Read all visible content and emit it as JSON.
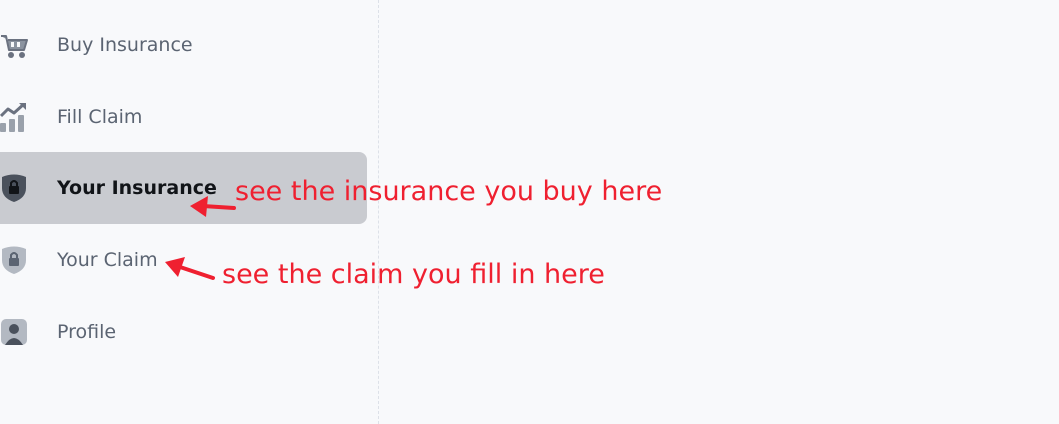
{
  "sidebar": {
    "items": [
      {
        "label": "Buy Insurance",
        "icon": "cart-icon",
        "active": false
      },
      {
        "label": "Fill Claim",
        "icon": "chart-trend-icon",
        "active": false
      },
      {
        "label": "Your Insurance",
        "icon": "shield-lock-icon",
        "active": true
      },
      {
        "label": "Your Claim",
        "icon": "shield-lock-icon",
        "active": false
      },
      {
        "label": "Profile",
        "icon": "user-icon",
        "active": false
      }
    ]
  },
  "annotations": {
    "insurance_note": "see the insurance you buy here",
    "claim_note": "see the claim you fill in here",
    "color": "#ef2030"
  },
  "colors": {
    "background": "#f8f9fb",
    "active_background": "#c9cbd0",
    "icon": "#6b7280",
    "active_icon": "#3f4650"
  }
}
